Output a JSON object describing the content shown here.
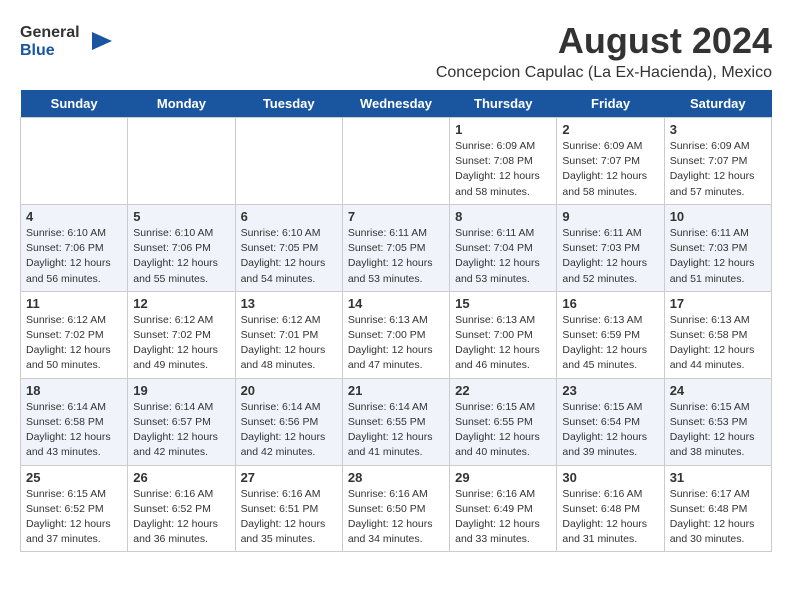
{
  "header": {
    "logo_general": "General",
    "logo_blue": "Blue",
    "month_title": "August 2024",
    "location": "Concepcion Capulac (La Ex-Hacienda), Mexico"
  },
  "days_of_week": [
    "Sunday",
    "Monday",
    "Tuesday",
    "Wednesday",
    "Thursday",
    "Friday",
    "Saturday"
  ],
  "weeks": [
    [
      {
        "date": "",
        "info": ""
      },
      {
        "date": "",
        "info": ""
      },
      {
        "date": "",
        "info": ""
      },
      {
        "date": "",
        "info": ""
      },
      {
        "date": "1",
        "info": "Sunrise: 6:09 AM\nSunset: 7:08 PM\nDaylight: 12 hours\nand 58 minutes."
      },
      {
        "date": "2",
        "info": "Sunrise: 6:09 AM\nSunset: 7:07 PM\nDaylight: 12 hours\nand 58 minutes."
      },
      {
        "date": "3",
        "info": "Sunrise: 6:09 AM\nSunset: 7:07 PM\nDaylight: 12 hours\nand 57 minutes."
      }
    ],
    [
      {
        "date": "4",
        "info": "Sunrise: 6:10 AM\nSunset: 7:06 PM\nDaylight: 12 hours\nand 56 minutes."
      },
      {
        "date": "5",
        "info": "Sunrise: 6:10 AM\nSunset: 7:06 PM\nDaylight: 12 hours\nand 55 minutes."
      },
      {
        "date": "6",
        "info": "Sunrise: 6:10 AM\nSunset: 7:05 PM\nDaylight: 12 hours\nand 54 minutes."
      },
      {
        "date": "7",
        "info": "Sunrise: 6:11 AM\nSunset: 7:05 PM\nDaylight: 12 hours\nand 53 minutes."
      },
      {
        "date": "8",
        "info": "Sunrise: 6:11 AM\nSunset: 7:04 PM\nDaylight: 12 hours\nand 53 minutes."
      },
      {
        "date": "9",
        "info": "Sunrise: 6:11 AM\nSunset: 7:03 PM\nDaylight: 12 hours\nand 52 minutes."
      },
      {
        "date": "10",
        "info": "Sunrise: 6:11 AM\nSunset: 7:03 PM\nDaylight: 12 hours\nand 51 minutes."
      }
    ],
    [
      {
        "date": "11",
        "info": "Sunrise: 6:12 AM\nSunset: 7:02 PM\nDaylight: 12 hours\nand 50 minutes."
      },
      {
        "date": "12",
        "info": "Sunrise: 6:12 AM\nSunset: 7:02 PM\nDaylight: 12 hours\nand 49 minutes."
      },
      {
        "date": "13",
        "info": "Sunrise: 6:12 AM\nSunset: 7:01 PM\nDaylight: 12 hours\nand 48 minutes."
      },
      {
        "date": "14",
        "info": "Sunrise: 6:13 AM\nSunset: 7:00 PM\nDaylight: 12 hours\nand 47 minutes."
      },
      {
        "date": "15",
        "info": "Sunrise: 6:13 AM\nSunset: 7:00 PM\nDaylight: 12 hours\nand 46 minutes."
      },
      {
        "date": "16",
        "info": "Sunrise: 6:13 AM\nSunset: 6:59 PM\nDaylight: 12 hours\nand 45 minutes."
      },
      {
        "date": "17",
        "info": "Sunrise: 6:13 AM\nSunset: 6:58 PM\nDaylight: 12 hours\nand 44 minutes."
      }
    ],
    [
      {
        "date": "18",
        "info": "Sunrise: 6:14 AM\nSunset: 6:58 PM\nDaylight: 12 hours\nand 43 minutes."
      },
      {
        "date": "19",
        "info": "Sunrise: 6:14 AM\nSunset: 6:57 PM\nDaylight: 12 hours\nand 42 minutes."
      },
      {
        "date": "20",
        "info": "Sunrise: 6:14 AM\nSunset: 6:56 PM\nDaylight: 12 hours\nand 42 minutes."
      },
      {
        "date": "21",
        "info": "Sunrise: 6:14 AM\nSunset: 6:55 PM\nDaylight: 12 hours\nand 41 minutes."
      },
      {
        "date": "22",
        "info": "Sunrise: 6:15 AM\nSunset: 6:55 PM\nDaylight: 12 hours\nand 40 minutes."
      },
      {
        "date": "23",
        "info": "Sunrise: 6:15 AM\nSunset: 6:54 PM\nDaylight: 12 hours\nand 39 minutes."
      },
      {
        "date": "24",
        "info": "Sunrise: 6:15 AM\nSunset: 6:53 PM\nDaylight: 12 hours\nand 38 minutes."
      }
    ],
    [
      {
        "date": "25",
        "info": "Sunrise: 6:15 AM\nSunset: 6:52 PM\nDaylight: 12 hours\nand 37 minutes."
      },
      {
        "date": "26",
        "info": "Sunrise: 6:16 AM\nSunset: 6:52 PM\nDaylight: 12 hours\nand 36 minutes."
      },
      {
        "date": "27",
        "info": "Sunrise: 6:16 AM\nSunset: 6:51 PM\nDaylight: 12 hours\nand 35 minutes."
      },
      {
        "date": "28",
        "info": "Sunrise: 6:16 AM\nSunset: 6:50 PM\nDaylight: 12 hours\nand 34 minutes."
      },
      {
        "date": "29",
        "info": "Sunrise: 6:16 AM\nSunset: 6:49 PM\nDaylight: 12 hours\nand 33 minutes."
      },
      {
        "date": "30",
        "info": "Sunrise: 6:16 AM\nSunset: 6:48 PM\nDaylight: 12 hours\nand 31 minutes."
      },
      {
        "date": "31",
        "info": "Sunrise: 6:17 AM\nSunset: 6:48 PM\nDaylight: 12 hours\nand 30 minutes."
      }
    ]
  ]
}
